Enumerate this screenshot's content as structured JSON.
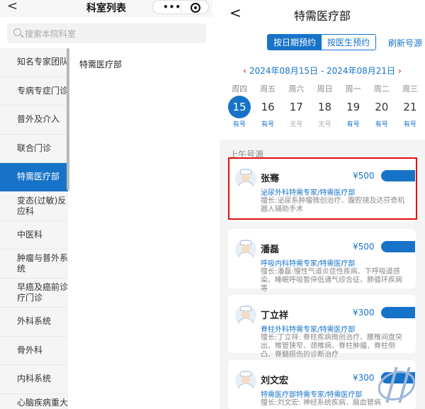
{
  "left": {
    "back_glyph": "<",
    "title": "科室列表",
    "capsule": {
      "menu_glyph": "•••",
      "icons": [
        "more-icon",
        "target-icon"
      ]
    },
    "search": {
      "placeholder": "搜索本院科室",
      "icon": "search-icon"
    },
    "departments": [
      {
        "label": "知名专家团队",
        "active": false
      },
      {
        "label": "专病专症门诊",
        "active": false
      },
      {
        "label": "普外及介入",
        "active": false
      },
      {
        "label": "联合门诊",
        "active": false
      },
      {
        "label": "特需医疗部",
        "active": true
      },
      {
        "label": "变态(过敏)反应科",
        "active": false
      },
      {
        "label": "中医科",
        "active": false
      },
      {
        "label": "肿瘤与普外系统",
        "active": false
      },
      {
        "label": "早癌及癌前诊疗门诊",
        "active": false
      },
      {
        "label": "外科系统",
        "active": false
      },
      {
        "label": "骨外科",
        "active": false
      },
      {
        "label": "内科系统",
        "active": false
      },
      {
        "label": "心脑疾病重大风险预防预测",
        "active": false
      }
    ],
    "sub_department": "特需医疗部"
  },
  "right": {
    "back_glyph": "<",
    "title": "特需医疗部",
    "tabs": [
      {
        "label": "按日期预约",
        "active": true
      },
      {
        "label": "按医生预约",
        "active": false
      }
    ],
    "refresh_label": "刷新号源",
    "date_range": {
      "prev": "‹",
      "text": "2024年08月15日 - 2024年08月21日",
      "next": "›"
    },
    "days": [
      {
        "weekday": "周四",
        "date": "15",
        "status": "有号",
        "available": true,
        "selected": true
      },
      {
        "weekday": "周五",
        "date": "16",
        "status": "有号",
        "available": true,
        "selected": false
      },
      {
        "weekday": "周六",
        "date": "17",
        "status": "无号",
        "available": false,
        "selected": false
      },
      {
        "weekday": "周日",
        "date": "18",
        "status": "无号",
        "available": false,
        "selected": false
      },
      {
        "weekday": "周一",
        "date": "19",
        "status": "有号",
        "available": true,
        "selected": false
      },
      {
        "weekday": "周二",
        "date": "20",
        "status": "有号",
        "available": true,
        "selected": false
      },
      {
        "weekday": "周三",
        "date": "21",
        "status": "有号",
        "available": true,
        "selected": false
      }
    ],
    "slot_title": "上午号源",
    "doctors": [
      {
        "name": "张骞",
        "price": "¥500",
        "dept": "泌尿外科特需专家/特需医疗部",
        "skill": "擅长:泌尿系肿瘤微创治疗、腹腔镜及达芬奇机器人辅助手术"
      },
      {
        "name": "潘磊",
        "price": "¥500",
        "dept": "呼吸内科特需专家/特需医疗部",
        "skill": "擅长:潘磊:慢性气道炎症性疾病、下呼吸道感染、睡眠呼吸暂停低通气综合征、肺循环疾病等"
      },
      {
        "name": "丁立祥",
        "price": "¥300",
        "dept": "脊柱外科特需专家/特需医疗部",
        "skill": "擅长:丁立祥: 脊柱疾病微创治疗、腰椎间盘突出、椎管狭窄、颈椎病、脊柱肿瘤、脊柱侧凸、脊髓损伤的诊断治疗"
      },
      {
        "name": "刘文宏",
        "price": "¥300",
        "dept": "特需医疗部特需专家/特需医疗部",
        "skill": "擅长:刘文宏: 神经系统疾病、脑血管病"
      }
    ]
  }
}
